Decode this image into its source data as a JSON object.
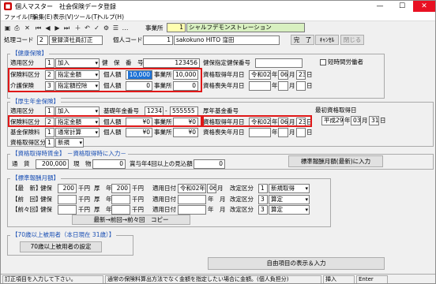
{
  "titlebar": {
    "title": "個人マスター　社会保険データ登録",
    "min": "—",
    "max": "☐",
    "close": "✕"
  },
  "menu": [
    "ファイル(F)",
    "編集(E)",
    "表示(V)",
    "ツール(T)",
    "ヘルプ(H)"
  ],
  "toolbar": {
    "office_label": "事業所",
    "office_no": "1",
    "office_name": "シャルフデモンストレーション"
  },
  "header": {
    "code_label": "処理コード",
    "code_no": "2",
    "code_name": "登録済社員訂正",
    "person_label": "個人コード",
    "person_no": "1",
    "person_name": "sakokuno  HITO 窪田",
    "btn_done": "完　了",
    "btn_cancel": "ｷｬﾝｾﾙ",
    "btn_close": "閉じる"
  },
  "health": {
    "title": "【健康保険】",
    "join_label": "適用区分",
    "join_no": "1",
    "join_val": "加入",
    "hno_label": "健　保　番　号",
    "hno_val": "123456",
    "hcert_label": "健保指定健保番号",
    "short_label": "短時間労働者",
    "premium_label": "保険料区分",
    "premium_no": "2",
    "premium_val": "指定金額",
    "indiv_label": "個人額",
    "indiv_val": "10,000",
    "office_label": "事業所",
    "office_val": "10,000",
    "qual_label": "資格取得年月日",
    "qual_era": "令和02",
    "qual_y_label": "年",
    "qual_m": "06",
    "qual_m_label": "月",
    "qual_d": "23",
    "qual_d_label": "日",
    "care_label": "介護保険",
    "care_no": "3",
    "care_val": "指定額控除",
    "care_indiv_label": "個人額",
    "care_indiv_val": "0",
    "care_office_label": "事業所",
    "care_office_val": "0",
    "loss_label": "資格喪失年月日",
    "loss_y": "年",
    "loss_m": "月",
    "loss_d": "日"
  },
  "pension": {
    "title": "【厚生年金保険】",
    "join_label": "適用区分",
    "join_no": "1",
    "join_val": "加入",
    "basic_label": "基礎年金番号",
    "basic_a": "1234",
    "basic_b": "-",
    "basic_c": "555555",
    "pno_label": "厚年基金番号",
    "latest_label": "最初資格取得日",
    "latest_era": "平成29",
    "latest_y": "年",
    "latest_m": "03",
    "latest_m_label": "月",
    "latest_d": "31",
    "latest_d_label": "日",
    "premium_label": "保険料区分",
    "premium_no": "2",
    "premium_val": "指定金額",
    "indiv_label": "個人額",
    "indiv_val": "¥0",
    "office_label": "事業所",
    "office_val": "¥0",
    "qual_label": "資格取得年月日",
    "qual_era": "令和02",
    "qual_y": "年",
    "qual_m": "06",
    "qual_m_label": "月",
    "qual_d": "23",
    "qual_d_label": "日",
    "fund_label": "基金保険料",
    "fund_no": "1",
    "fund_val": "通常計算",
    "fund_indiv_label": "個人額",
    "fund_indiv_val": "¥0",
    "fund_office_label": "事業所",
    "fund_office_val": "¥0",
    "loss_label": "資格喪失年月日",
    "loss_y": "年",
    "loss_m": "月",
    "loss_d": "日",
    "qualcls_label": "資格取得区分",
    "qualcls_no": "1",
    "qualcls_val": "新規"
  },
  "acquisition": {
    "title": "【資格取得時賃金】 －資格取得時に入力－",
    "currency_label": "通　貨",
    "currency_val": "200,000",
    "goods_label": "現　物",
    "goods_val": "0",
    "bonus_label": "賞与年4回以上の見込額",
    "bonus_val": "0",
    "btn_std": "標準報酬月額(最新)に入力"
  },
  "standard": {
    "title": "【標準報酬月額】",
    "rows": [
      {
        "label": "【最　新】",
        "h_label": "健保",
        "h_val": "200",
        "h_unit": "千円",
        "p_label": "厚　年",
        "p_val": "200",
        "p_unit": "千円",
        "date_label": "適用日付",
        "date_val": "令和02年",
        "date_m": "06",
        "date_m_label": "月",
        "rev_label": "改定区分",
        "rev_no": "1",
        "rev_val": "新規取得"
      },
      {
        "label": "【前　回】",
        "h_label": "健保",
        "h_val": "",
        "h_unit": "千円",
        "p_label": "厚　年",
        "p_val": "",
        "p_unit": "千円",
        "date_label": "適用日付",
        "date_val": "",
        "date_m": "",
        "date_m_label": "年　月",
        "rev_label": "改定区分",
        "rev_no": "3",
        "rev_val": "算定"
      },
      {
        "label": "【前々回】",
        "h_label": "健保",
        "h_val": "",
        "h_unit": "千円",
        "p_label": "厚　年",
        "p_val": "",
        "p_unit": "千円",
        "date_label": "適用日付",
        "date_val": "",
        "date_m": "",
        "date_m_label": "年　月",
        "rev_label": "改定区分",
        "rev_no": "3",
        "rev_val": "算定"
      }
    ],
    "btn_copy": "最新→前回→前々回　コピー"
  },
  "over70": {
    "title": "【70歳以上被用者（本日現在 31歳）】",
    "btn": "70歳以上被用者の設定"
  },
  "btn_free": "自由項目の表示＆入力",
  "status": {
    "msg1": "訂正項目を入力して下さい。",
    "msg2": "通常の保険料算出方法でなく金額を指定したい場合に金額。(個人負担分)",
    "ins": "挿入",
    "enter": "Enter"
  }
}
